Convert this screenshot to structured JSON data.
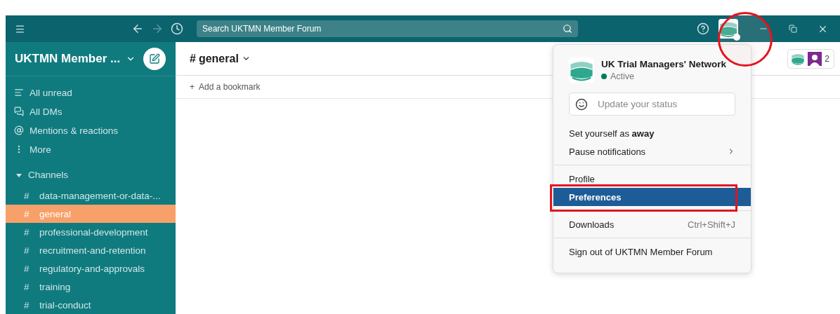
{
  "titlebar": {
    "search_placeholder": "Search UKTMN Member Forum"
  },
  "workspace": {
    "name": "UKTMN Member ..."
  },
  "nav": [
    {
      "label": "All unread"
    },
    {
      "label": "All DMs"
    },
    {
      "label": "Mentions & reactions"
    },
    {
      "label": "More"
    }
  ],
  "channels_section": {
    "label": "Channels",
    "expanded": true,
    "channels": [
      {
        "prefix": "#",
        "name": "data-management-or-data-...",
        "selected": false
      },
      {
        "prefix": "#",
        "name": "general",
        "selected": true
      },
      {
        "prefix": "#",
        "name": "professional-development",
        "selected": false
      },
      {
        "prefix": "#",
        "name": "recruitment-and-retention",
        "selected": false
      },
      {
        "prefix": "#",
        "name": "regulatory-and-approvals",
        "selected": false
      },
      {
        "prefix": "#",
        "name": "training",
        "selected": false
      },
      {
        "prefix": "#",
        "name": "trial-conduct",
        "selected": false
      }
    ]
  },
  "channel_header": {
    "prefix": "#",
    "name": "general",
    "members_count": "2"
  },
  "bookmark_bar": {
    "plus": "+",
    "label": "Add a bookmark"
  },
  "user_menu": {
    "name": "UK Trial Managers' Network",
    "status": "Active",
    "active": true,
    "status_field": {
      "placeholder": "Update your status"
    },
    "sections": [
      [
        {
          "label": "Set yourself as **away**",
          "kind": "plain",
          "selected": false
        },
        {
          "label": "Pause notifications",
          "kind": "submenu",
          "selected": false
        }
      ],
      [
        {
          "label": "Profile",
          "kind": "plain",
          "selected": false
        },
        {
          "label": "Preferences",
          "kind": "plain",
          "selected": true
        }
      ],
      [
        {
          "label": "Downloads",
          "kind": "shortcut",
          "shortcut": "Ctrl+Shift+J",
          "selected": false
        }
      ],
      [
        {
          "label": "Sign out of UKTMN Member Forum",
          "kind": "plain",
          "selected": false
        }
      ]
    ]
  },
  "annotations": [
    {
      "kind": "circle"
    },
    {
      "kind": "rect"
    }
  ]
}
